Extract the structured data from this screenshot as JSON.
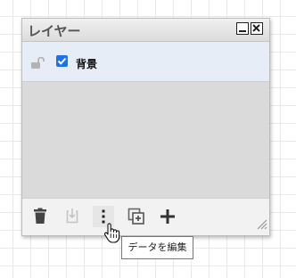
{
  "panel": {
    "title": "レイヤー",
    "window_controls": {
      "minimize_icon": "minimize-icon",
      "close_icon": "close-icon"
    }
  },
  "layers": [
    {
      "name": "背景",
      "visible": true,
      "locked": false
    }
  ],
  "toolbar": {
    "buttons": [
      {
        "icon": "trash-icon"
      },
      {
        "icon": "merge-down-icon"
      },
      {
        "icon": "more-vertical-icon"
      },
      {
        "icon": "duplicate-icon"
      },
      {
        "icon": "plus-icon"
      }
    ]
  },
  "tooltip": {
    "text": "データを編集"
  },
  "colors": {
    "accent": "#1a73e8",
    "selected_row": "#e6edf7"
  }
}
